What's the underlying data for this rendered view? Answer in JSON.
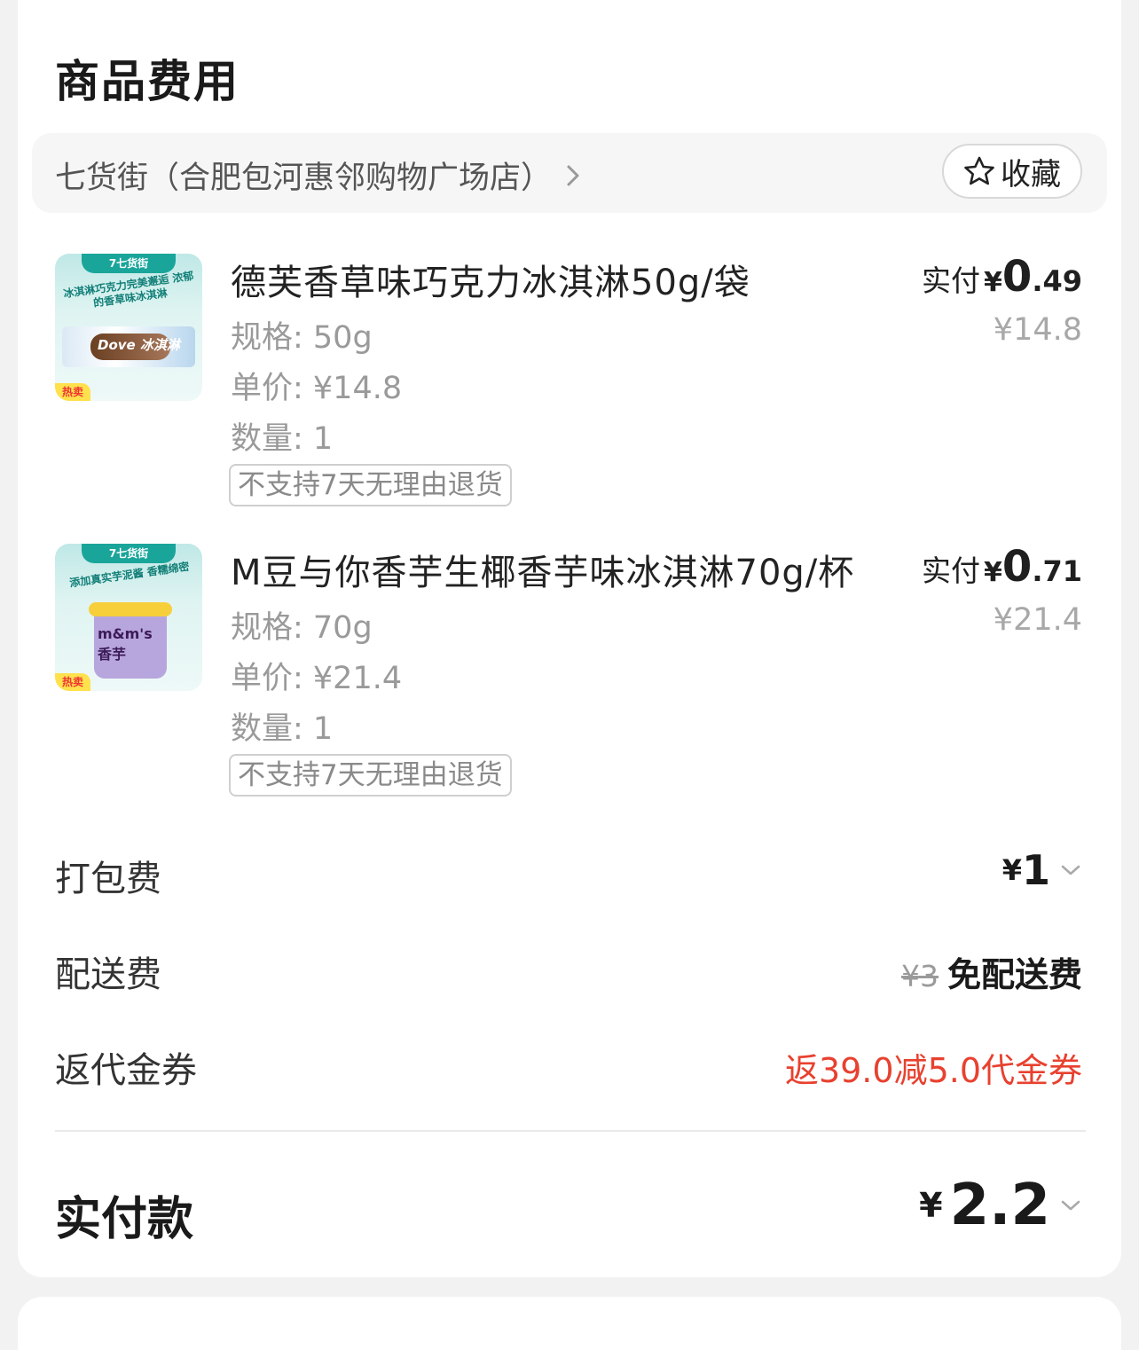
{
  "section": {
    "title": "商品费用"
  },
  "store": {
    "name": "七货街（合肥包河惠邻购物广场店）",
    "favorite_label": "收藏"
  },
  "items": [
    {
      "name": "德芙香草味巧克力冰淇淋50g/袋",
      "spec": "规格: 50g",
      "unit_price": "单价: ¥14.8",
      "quantity": "数量: 1",
      "tag": "不支持7天无理由退货",
      "paid_label": "实付",
      "paid_currency": "¥",
      "paid_int": "0",
      "paid_dec": ".49",
      "original_price": "¥14.8",
      "thumb": {
        "brand": "7七货街",
        "slogan": "冰淇淋巧克力完美邂逅 浓郁的香草味冰淇淋",
        "product": "Dove 冰淇淋",
        "badge": "热卖"
      }
    },
    {
      "name": "M豆与你香芋生椰香芋味冰淇淋70g/杯",
      "spec": "规格: 70g",
      "unit_price": "单价: ¥21.4",
      "quantity": "数量: 1",
      "tag": "不支持7天无理由退货",
      "paid_label": "实付",
      "paid_currency": "¥",
      "paid_int": "0",
      "paid_dec": ".71",
      "original_price": "¥21.4",
      "thumb": {
        "brand": "7七货街",
        "slogan": "添加真实芋泥酱 香糯绵密",
        "product": "m&m's 香芋",
        "badge": "热卖"
      }
    }
  ],
  "packing": {
    "label": "打包费",
    "currency": "¥",
    "value": "1"
  },
  "delivery": {
    "label": "配送费",
    "original": "¥3",
    "value": "免配送费"
  },
  "voucher": {
    "label": "返代金券",
    "value": "返39.0减5.0代金券"
  },
  "total": {
    "label": "实付款",
    "currency": "¥",
    "value": "2.2"
  },
  "colors": {
    "accent_red": "#e8412f",
    "brand_teal": "#1aa59b",
    "background": "#f2f2f2"
  }
}
